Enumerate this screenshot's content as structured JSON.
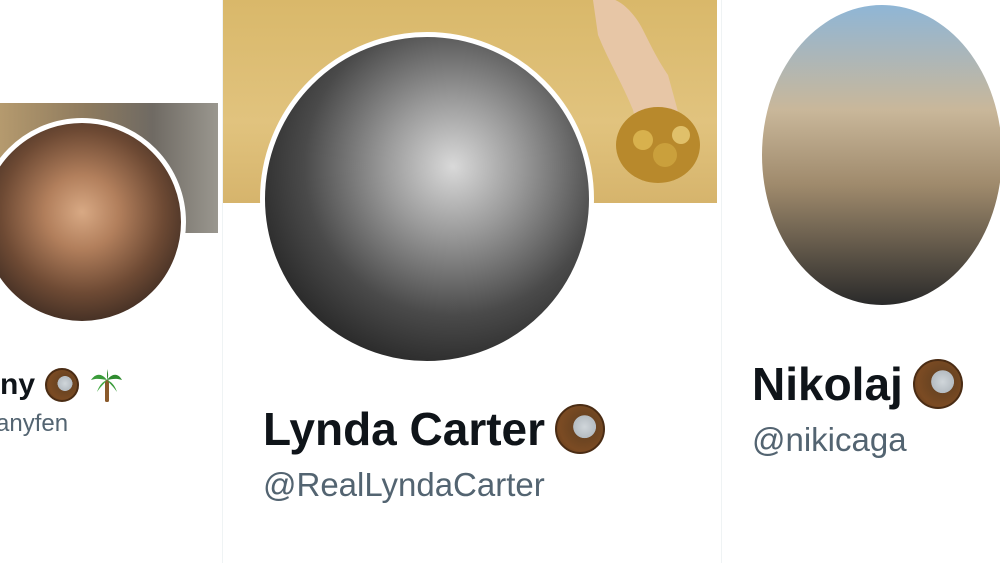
{
  "cards": {
    "left": {
      "name": "ny",
      "handle": "anyfen",
      "emojis": [
        "coconut-icon",
        "palm-tree-icon"
      ]
    },
    "center": {
      "name": "Lynda Carter",
      "handle": "@RealLyndaCarter",
      "emojis": [
        "coconut-icon"
      ]
    },
    "right": {
      "name": "Nikolaj",
      "handle": "@nikicaga",
      "emojis": [
        "coconut-icon"
      ]
    }
  },
  "colors": {
    "name_text": "#0f1419",
    "handle_text": "#536471",
    "background": "#ffffff"
  }
}
